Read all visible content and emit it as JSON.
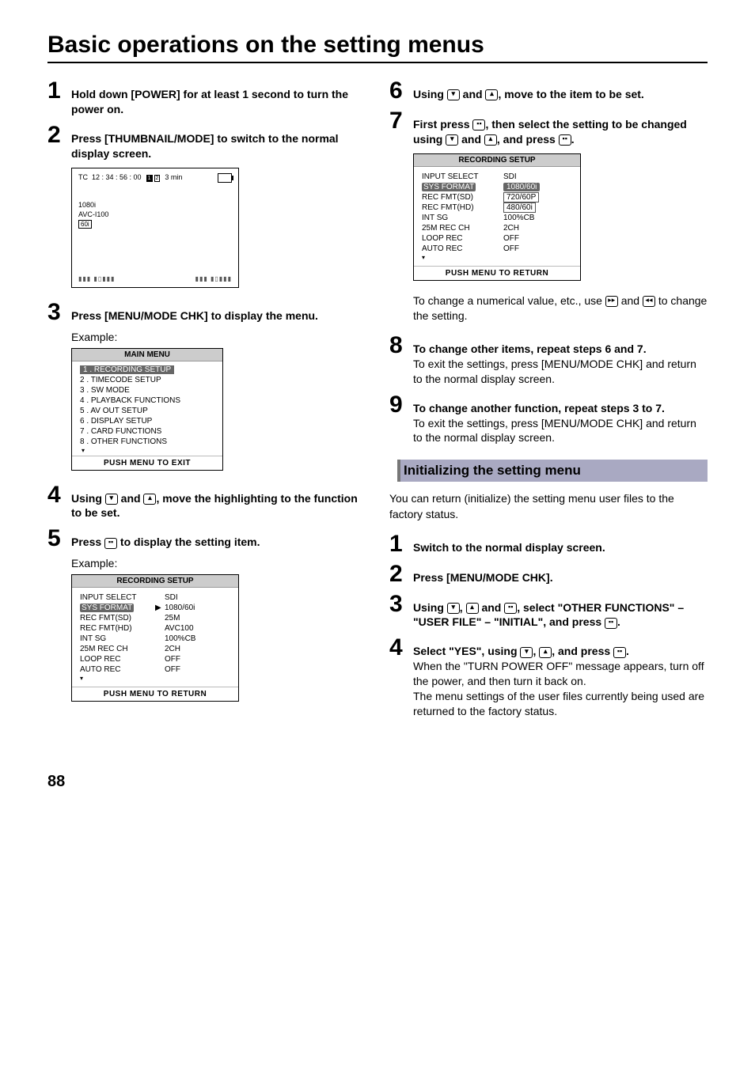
{
  "pageNumber": "88",
  "title": "Basic operations on the setting menus",
  "left": {
    "step1": "Hold down [POWER] for at least 1 second to turn the power on.",
    "step2": "Press [THUMBNAIL/MODE] to switch to the normal display screen.",
    "screen": {
      "tc_label": "TC",
      "tc_value": "12 : 34 : 56 : 00",
      "cards": [
        "1",
        "2"
      ],
      "remain": "3 min",
      "line1": "1080i",
      "line2": "AVC-I100",
      "line3": "60i",
      "meter_left": "▮▮▮ ▮▯▮▮▮",
      "meter_right": "▮▮▮ ▮▯▮▮▮"
    },
    "step3": "Press [MENU/MODE CHK] to display the menu.",
    "example": "Example:",
    "mainMenu": {
      "title": "MAIN MENU",
      "items": [
        "1 . RECORDING SETUP",
        "2 . TIMECODE SETUP",
        "3 . SW MODE",
        "4 . PLAYBACK FUNCTIONS",
        "5 . AV OUT SETUP",
        "6 . DISPLAY SETUP",
        "7 . CARD FUNCTIONS",
        "8 . OTHER FUNCTIONS"
      ],
      "footer": "PUSH MENU TO EXIT"
    },
    "step4_a": "Using ",
    "step4_b": " and ",
    "step4_c": ", move the highlighting to the function to be set.",
    "step5_a": "Press ",
    "step5_b": " to display the setting item.",
    "recSetup1": {
      "title": "RECORDING SETUP",
      "rows": [
        {
          "l": "INPUT SELECT",
          "r": "SDI"
        },
        {
          "l": "SYS FORMAT",
          "r": "1080/60i",
          "sel": true,
          "arrow": "▶"
        },
        {
          "l": "REC FMT(SD)",
          "r": "25M"
        },
        {
          "l": "REC FMT(HD)",
          "r": "AVC100"
        },
        {
          "l": "INT SG",
          "r": "100%CB"
        },
        {
          "l": "25M REC CH",
          "r": "2CH"
        },
        {
          "l": "LOOP REC",
          "r": "OFF"
        },
        {
          "l": "AUTO REC",
          "r": "OFF"
        }
      ],
      "more": "▾",
      "footer": "PUSH  MENU TO RETURN"
    }
  },
  "right": {
    "step6_a": "Using ",
    "step6_b": " and ",
    "step6_c": ", move to the item to be set.",
    "step7_a": "First press ",
    "step7_b": ", then select the setting to be changed using ",
    "step7_c": " and ",
    "step7_d": ", and press ",
    "step7_e": ".",
    "recSetup2": {
      "title": "RECORDING SETUP",
      "rows": [
        {
          "l": "INPUT SELECT",
          "r": "SDI"
        },
        {
          "l": "SYS FORMAT",
          "r": "1080/60i",
          "sel": true,
          "selval": true
        },
        {
          "l": "REC FMT(SD)",
          "r": "720/60P",
          "box": true
        },
        {
          "l": "REC FMT(HD)",
          "r": "480/60i",
          "box": true
        },
        {
          "l": "INT SG",
          "r": "100%CB"
        },
        {
          "l": "25M REC CH",
          "r": "2CH"
        },
        {
          "l": "LOOP REC",
          "r": "OFF"
        },
        {
          "l": "AUTO REC",
          "r": "OFF"
        }
      ],
      "more": "▾",
      "footer": "PUSH  MENU TO RETURN"
    },
    "note_a": "To change a numerical value, etc., use ",
    "note_b": " and ",
    "note_c": " to change the setting.",
    "step8_bold": "To change other items, repeat steps 6 and 7.",
    "step8_p1": "To exit the settings, press [MENU/MODE CHK] and return to the normal display screen.",
    "step9_bold": "To change another function, repeat steps 3 to 7.",
    "step9_p1": "To exit the settings, press [MENU/MODE CHK] and return to the normal display screen.",
    "sectionTitle": "Initializing the setting menu",
    "intro": "You can return (initialize) the setting menu user files to the factory status.",
    "istep1": "Switch to the normal display screen.",
    "istep2": "Press [MENU/MODE CHK].",
    "istep3_a": "Using ",
    "istep3_b": ", ",
    "istep3_c": " and ",
    "istep3_d": ", select \"OTHER FUNCTIONS\" – \"USER FILE\" – \"INITIAL\", and press ",
    "istep3_e": ".",
    "istep4_a": "Select \"YES\", using ",
    "istep4_b": ", ",
    "istep4_c": ", and press ",
    "istep4_d": ".",
    "istep4_p1": "When the \"TURN POWER OFF\" message appears, turn off the power, and then turn it back on.",
    "istep4_p2": "The menu settings of the user files currently being used are returned to the factory status."
  }
}
